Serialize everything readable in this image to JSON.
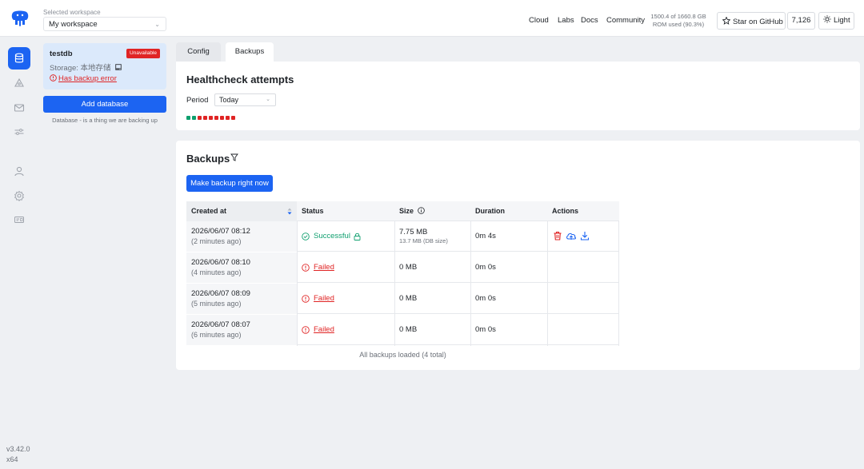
{
  "header": {
    "workspace_label": "Selected workspace",
    "workspace_value": "My workspace",
    "nav": [
      "Cloud",
      "Labs",
      "Docs",
      "Community"
    ],
    "rom_line1": "1500.4 of 1660.8 GB",
    "rom_line2": "ROM used (90.3%)",
    "github_label": "Star on GitHub",
    "github_count": "7,126",
    "theme_label": "Light"
  },
  "sidebar": {
    "items": [
      "databases-icon",
      "storages-icon",
      "notifiers-icon",
      "settings-sliders-icon",
      "users-icon",
      "gear-icon",
      "billing-icon"
    ],
    "version": "v3.42.0",
    "arch": "x64"
  },
  "database_card": {
    "name": "testdb",
    "badge": "Unavailable",
    "storage": "Storage: 本地存储",
    "error": "Has backup error",
    "add_button": "Add database",
    "hint": "Database - is a thing we are backing up"
  },
  "tabs": [
    "Config",
    "Backups"
  ],
  "healthcheck": {
    "title": "Healthcheck attempts",
    "period_label": "Period",
    "period_value": "Today",
    "attempts": [
      "success",
      "success",
      "fail",
      "fail",
      "fail",
      "fail",
      "fail",
      "fail",
      "fail"
    ],
    "colors": {
      "success": "#0e9f6e",
      "fail": "#e02424"
    }
  },
  "backups": {
    "title": "Backups",
    "make_button": "Make backup right now",
    "columns": [
      "Created at",
      "Status",
      "Size",
      "Duration",
      "Actions"
    ],
    "rows": [
      {
        "created": "2026/06/07 08:12",
        "ago": "(2 minutes ago)",
        "status": "Successful",
        "size": "7.75 MB",
        "db_size": "13.7 MB (DB size)",
        "duration": "0m 4s"
      },
      {
        "created": "2026/06/07 08:10",
        "ago": "(4 minutes ago)",
        "status": "Failed",
        "size": "0 MB",
        "db_size": "",
        "duration": "0m 0s"
      },
      {
        "created": "2026/06/07 08:09",
        "ago": "(5 minutes ago)",
        "status": "Failed",
        "size": "0 MB",
        "db_size": "",
        "duration": "0m 0s"
      },
      {
        "created": "2026/06/07 08:07",
        "ago": "(6 minutes ago)",
        "status": "Failed",
        "size": "0 MB",
        "db_size": "",
        "duration": "0m 0s"
      }
    ],
    "footer": "All backups loaded (4 total)"
  },
  "colors": {
    "accent": "#1c64f2",
    "danger": "#e02424",
    "success": "#0e9f6e"
  }
}
